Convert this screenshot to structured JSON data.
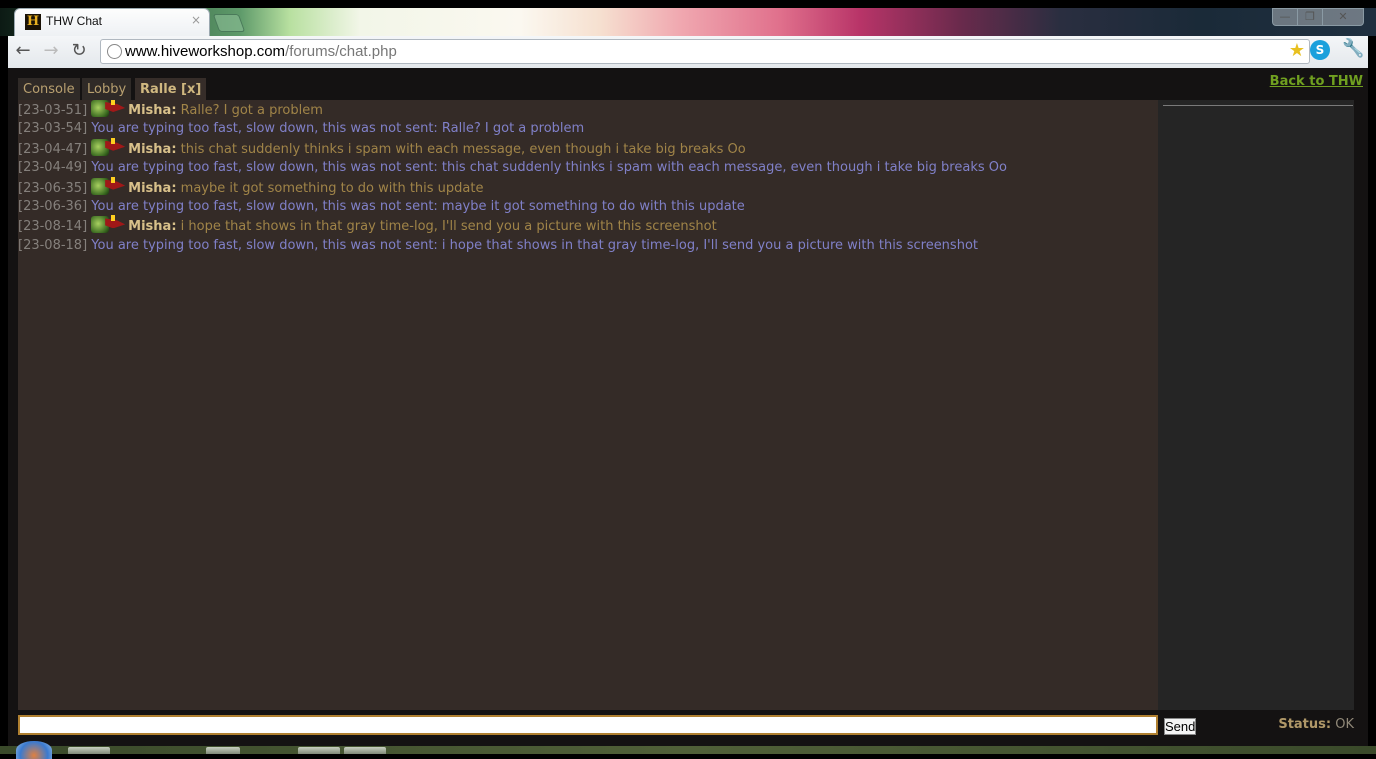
{
  "browser": {
    "tab_title": "THW Chat",
    "favicon_letter": "H",
    "tab_close": "×",
    "url_host": "www.hiveworkshop.com",
    "url_path": "/forums/chat.php",
    "nav": {
      "back": "←",
      "forward": "→",
      "reload": "↻"
    },
    "star": "★",
    "skype": "S",
    "wrench": "🔧",
    "window": {
      "minimize": "—",
      "maximize": "❐",
      "close": "✕"
    }
  },
  "chat": {
    "tabs": [
      {
        "label": "Console"
      },
      {
        "label": "Lobby"
      },
      {
        "label": "Ralle [x]",
        "active": true
      }
    ],
    "back_link": "Back to THW",
    "lines": [
      {
        "type": "user",
        "time": "[23-03-51]",
        "nick": "Misha:",
        "text": "Ralle? I got a problem"
      },
      {
        "type": "system",
        "time": "[23-03-54]",
        "text": "You are typing too fast, slow down, this was not sent: Ralle? I got a problem"
      },
      {
        "type": "user",
        "time": "[23-04-47]",
        "nick": "Misha:",
        "text": "this chat suddenly thinks i spam with each message, even though i take big breaks Oo"
      },
      {
        "type": "system",
        "time": "[23-04-49]",
        "text": "You are typing too fast, slow down, this was not sent: this chat suddenly thinks i spam with each message, even though i take big breaks Oo"
      },
      {
        "type": "user",
        "time": "[23-06-35]",
        "nick": "Misha:",
        "text": "maybe it got something to do with this update"
      },
      {
        "type": "system",
        "time": "[23-06-36]",
        "text": "You are typing too fast, slow down, this was not sent: maybe it got something to do with this update"
      },
      {
        "type": "user",
        "time": "[23-08-14]",
        "nick": "Misha:",
        "text": "i hope that shows in that gray time-log, I'll send you a picture with this screenshot"
      },
      {
        "type": "system",
        "time": "[23-08-18]",
        "text": "You are typing too fast, slow down, this was not sent: i hope that shows in that gray time-log, I'll send you a picture with this screenshot"
      }
    ],
    "input_value": "",
    "send_label": "Send",
    "status_label": "Status:",
    "status_value": "OK"
  }
}
